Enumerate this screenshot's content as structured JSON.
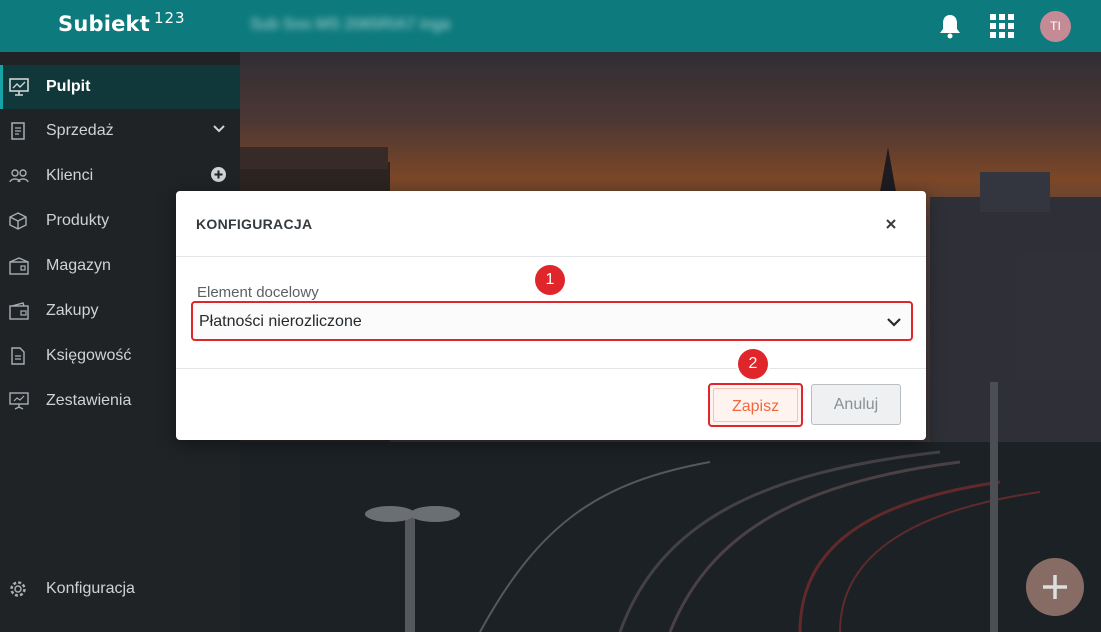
{
  "app": {
    "brand": "Subiekt",
    "brand_sup": "123",
    "company_name": "Sub Soo MS 2065RIA7 inga"
  },
  "user": {
    "initials": "TI"
  },
  "sidebar": {
    "items": [
      {
        "label": "Pulpit",
        "icon": "monitor-icon"
      },
      {
        "label": "Sprzedaż",
        "icon": "receipt-icon"
      },
      {
        "label": "Klienci",
        "icon": "users-icon"
      },
      {
        "label": "Produkty",
        "icon": "box-icon"
      },
      {
        "label": "Magazyn",
        "icon": "warehouse-icon"
      },
      {
        "label": "Zakupy",
        "icon": "wallet-icon"
      },
      {
        "label": "Księgowość",
        "icon": "document-icon"
      },
      {
        "label": "Zestawienia",
        "icon": "presentation-icon"
      }
    ],
    "footer_label": "Konfiguracja"
  },
  "modal": {
    "title": "KONFIGURACJA",
    "field_label": "Element docelowy",
    "select_value": "Płatności nierozliczone",
    "save_label": "Zapisz",
    "cancel_label": "Anuluj"
  },
  "markers": {
    "one": "1",
    "two": "2"
  },
  "colors": {
    "topbar": "#0d7a7d",
    "sidebar": "#1f2326",
    "accent_red": "#e0262a",
    "save_text": "#f2683e"
  }
}
